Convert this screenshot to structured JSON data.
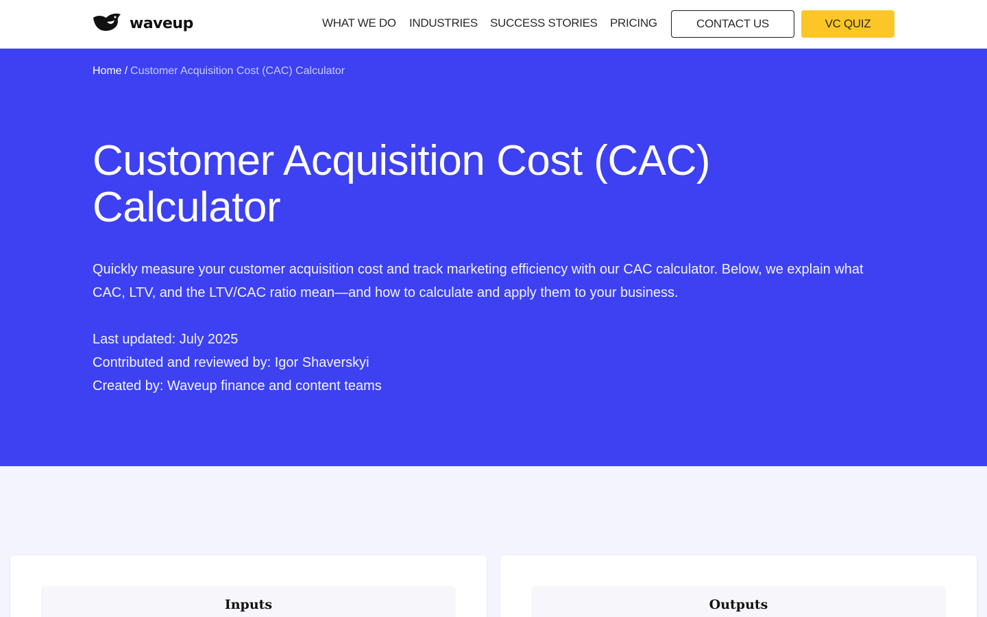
{
  "brand": {
    "name": "waveup",
    "logo_icon": "bird-icon"
  },
  "nav": {
    "items": [
      {
        "label": "WHAT WE DO"
      },
      {
        "label": "INDUSTRIES"
      },
      {
        "label": "SUCCESS STORIES"
      },
      {
        "label": "PRICING"
      }
    ],
    "contact_label": "CONTACT US",
    "quiz_label": "VC QUIZ"
  },
  "breadcrumb": {
    "home": "Home",
    "separator": "/",
    "current": "Customer Acquisition Cost (CAC) Calculator"
  },
  "hero": {
    "title": "Customer Acquisition Cost (CAC) Calculator",
    "description": "Quickly measure your customer acquisition cost and track marketing efficiency with our CAC calculator. Below, we explain what CAC, LTV, and the LTV/CAC ratio mean—and how to calculate and apply them to your business.",
    "last_updated": "Last updated: July 2025",
    "contributed": "Contributed and reviewed by: Igor Shaverskyi",
    "created": "Created by: Waveup finance and content teams"
  },
  "calculator": {
    "inputs_title": "Inputs",
    "outputs_title": "Outputs"
  },
  "colors": {
    "hero_bg": "#3d41f2",
    "accent_yellow": "#fdc627",
    "page_bg": "#f3f4fd"
  }
}
